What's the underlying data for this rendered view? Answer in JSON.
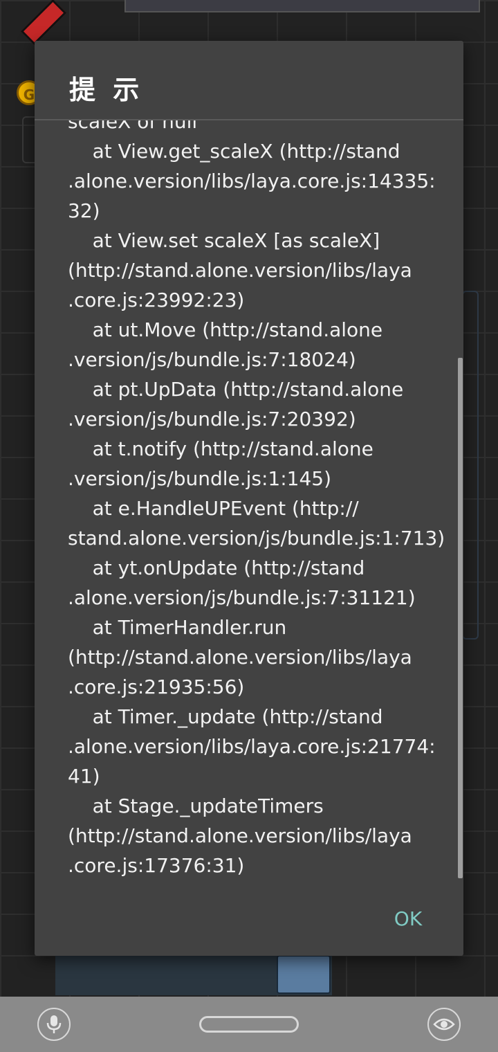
{
  "game": {
    "coin_letter": "G"
  },
  "dialog": {
    "title": "提 示",
    "message_lines": [
      "scaleX of null",
      "    at View.get_scaleX (http://stand",
      ".alone.version/libs/laya.core.js:14335:",
      "32)",
      "    at View.set scaleX [as scaleX]",
      "(http://stand.alone.version/libs/laya",
      ".core.js:23992:23)",
      "    at ut.Move (http://stand.alone",
      ".version/js/bundle.js:7:18024)",
      "    at pt.UpData (http://stand.alone",
      ".version/js/bundle.js:7:20392)",
      "    at t.notify (http://stand.alone",
      ".version/js/bundle.js:1:145)",
      "    at e.HandleUPEvent (http://",
      "stand.alone.version/js/bundle.js:1:713)",
      "    at yt.onUpdate (http://stand",
      ".alone.version/js/bundle.js:7:31121)",
      "    at TimerHandler.run",
      "(http://stand.alone.version/libs/laya",
      ".core.js:21935:56)",
      "    at Timer._update (http://stand",
      ".alone.version/libs/laya.core.js:21774:",
      "41)",
      "    at Stage._updateTimers",
      "(http://stand.alone.version/libs/laya",
      ".core.js:17376:31)"
    ],
    "ok_label": "OK"
  },
  "navbar": {
    "mic_icon": "microphone-icon",
    "home_icon": "home-pill",
    "eye_icon": "eye-icon"
  },
  "colors": {
    "dialog_bg": "#424242",
    "ok_text": "#80cbc4",
    "navbar_bg": "#8a8a8a"
  }
}
